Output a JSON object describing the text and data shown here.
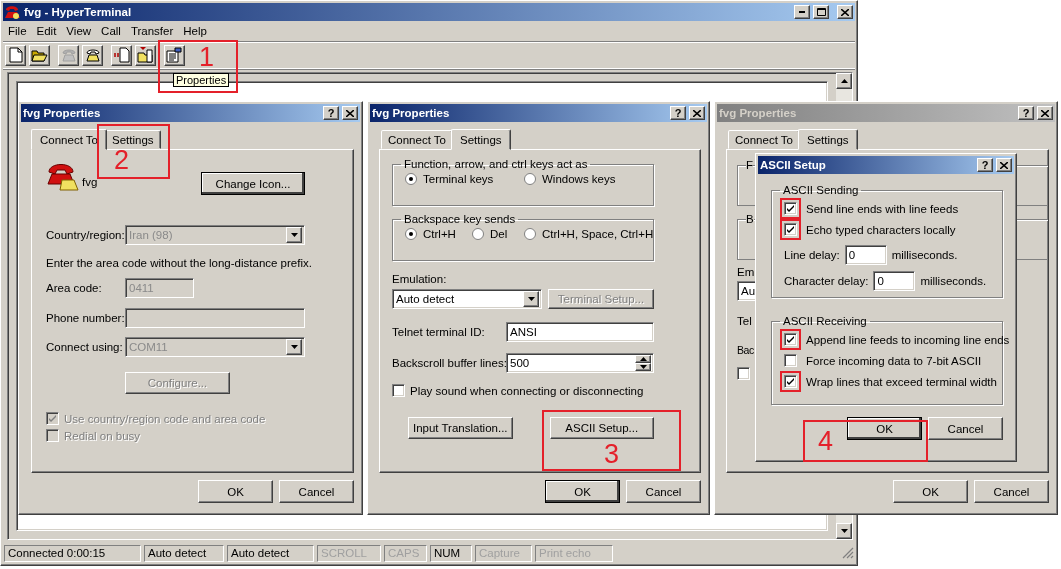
{
  "window": {
    "title": "fvg - HyperTerminal"
  },
  "menu": [
    "File",
    "Edit",
    "View",
    "Call",
    "Transfer",
    "Help"
  ],
  "toolbar": [
    [
      {
        "kind": "new",
        "disabled": false
      },
      {
        "kind": "open",
        "disabled": false
      }
    ],
    [
      {
        "kind": "disconnect",
        "disabled": true
      },
      {
        "kind": "dial",
        "disabled": false
      }
    ],
    [
      {
        "kind": "send",
        "disabled": false
      },
      {
        "kind": "receive",
        "disabled": false
      }
    ],
    [
      {
        "kind": "properties",
        "disabled": false
      }
    ]
  ],
  "tooltip": "Properties",
  "status_bar": [
    {
      "text": "Connected 0:00:15",
      "disabled": false
    },
    {
      "text": "Auto detect",
      "disabled": false
    },
    {
      "text": "Auto detect",
      "disabled": false
    },
    {
      "text": "SCROLL",
      "disabled": true
    },
    {
      "text": "CAPS",
      "disabled": true
    },
    {
      "text": "NUM",
      "disabled": false
    },
    {
      "text": "Capture",
      "disabled": true
    },
    {
      "text": "Print echo",
      "disabled": true
    }
  ],
  "connect_dialog": {
    "title": "fvg Properties",
    "active": true,
    "help": "?",
    "tabs": [
      {
        "label": "Connect To",
        "selected": true
      },
      {
        "label": "Settings",
        "selected": false
      }
    ],
    "name": "fvg",
    "change_icon": "Change Icon...",
    "fields": [
      {
        "kind": "combo",
        "label": "Country/region:",
        "value": "Iran (98)",
        "disabled": true
      },
      {
        "kind": "note",
        "label": "Enter the area code without the long-distance prefix."
      },
      {
        "kind": "short",
        "label": "Area code:",
        "value": "0411",
        "disabled": true
      },
      {
        "kind": "text",
        "label": "Phone number:",
        "disabled": true
      },
      {
        "kind": "combo",
        "label": "Connect using:",
        "value": "COM11",
        "disabled": true
      }
    ],
    "configure": {
      "label": "Configure...",
      "disabled": true
    },
    "checkboxes": [
      {
        "label": "Use country/region code and area code",
        "checked": true,
        "disabled": true
      },
      {
        "label": "Redial on busy",
        "checked": false,
        "disabled": true
      }
    ],
    "buttons": [
      {
        "label": "OK",
        "default": false
      },
      {
        "label": "Cancel",
        "default": false
      }
    ]
  },
  "settings_dialog": {
    "title": "fvg Properties",
    "active": true,
    "help": "?",
    "tabs": [
      {
        "label": "Connect To",
        "selected": false
      },
      {
        "label": "Settings",
        "selected": true
      }
    ],
    "groups": [
      {
        "legend": "Function, arrow, and ctrl keys act as",
        "options": [
          {
            "label": "Terminal keys",
            "selected": true
          },
          {
            "label": "Windows keys",
            "selected": false
          }
        ]
      },
      {
        "legend": "Backspace key sends",
        "options": [
          {
            "label": "Ctrl+H",
            "selected": true
          },
          {
            "label": "Del",
            "selected": false
          },
          {
            "label": "Ctrl+H, Space, Ctrl+H",
            "selected": false
          }
        ]
      }
    ],
    "emulation_label": "Emulation:",
    "emulation_value": "Auto detect",
    "terminal_setup": {
      "label": "Terminal Setup...",
      "disabled": true
    },
    "fields": [
      {
        "kind": "text",
        "label": "Telnet terminal ID:",
        "value": "ANSI"
      },
      {
        "kind": "spin",
        "label": "Backscroll buffer lines:",
        "value": "500"
      }
    ],
    "checkbox": {
      "label": "Play sound when connecting or disconnecting",
      "checked": false
    },
    "actions": [
      "Input Translation...",
      "ASCII Setup..."
    ],
    "buttons": [
      {
        "label": "OK",
        "default": true
      },
      {
        "label": "Cancel",
        "default": false
      }
    ]
  },
  "settings_dialog_behind": {
    "title": "fvg Properties",
    "active": false,
    "help": "?",
    "tabs": [
      {
        "label": "Connect To",
        "selected": false
      },
      {
        "label": "Settings",
        "selected": true
      }
    ],
    "fragments": {
      "group_1": "F",
      "group_2": "B",
      "emulation": "Em",
      "emulation_value": "Au",
      "telnet": "Tel",
      "backscroll": "Bac",
      "checked": false
    },
    "buttons": [
      {
        "label": "OK",
        "default": false
      },
      {
        "label": "Cancel",
        "default": false
      }
    ]
  },
  "ascii_setup": {
    "title": "ASCII Setup",
    "active": true,
    "help": "?",
    "sending": {
      "legend": "ASCII Sending",
      "checkboxes": [
        {
          "label": "Send line ends with line feeds",
          "checked": true,
          "highlighted": true
        },
        {
          "label": "Echo typed characters locally",
          "checked": true,
          "highlighted": true
        }
      ],
      "delays": [
        {
          "label": "Line delay:",
          "value": "0",
          "unit": "milliseconds."
        },
        {
          "label": "Character delay:",
          "value": "0",
          "unit": "milliseconds."
        }
      ]
    },
    "receiving": {
      "legend": "ASCII Receiving",
      "checkboxes": [
        {
          "label": "Append line feeds to incoming line ends",
          "checked": true,
          "highlighted": true
        },
        {
          "label": "Force incoming data to 7-bit ASCII",
          "checked": false,
          "highlighted": false
        },
        {
          "label": "Wrap lines that exceed terminal width",
          "checked": true,
          "highlighted": true
        }
      ]
    },
    "buttons": [
      {
        "label": "OK",
        "default": true
      },
      {
        "label": "Cancel",
        "default": false
      }
    ]
  },
  "annotations": [
    {
      "label": "1"
    },
    {
      "label": "2"
    },
    {
      "label": "3"
    },
    {
      "label": "4"
    }
  ]
}
